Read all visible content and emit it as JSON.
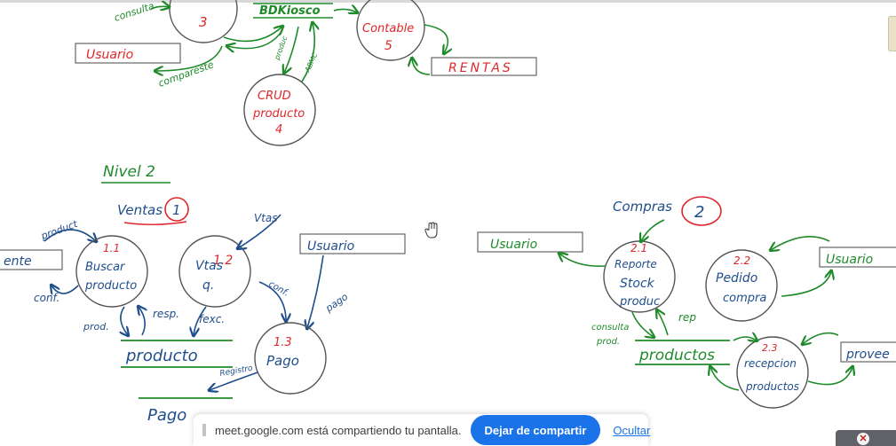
{
  "colors": {
    "blue": "#1f4e8c",
    "red": "#e0262b",
    "green": "#1f8a2a"
  },
  "level0": {
    "process3": "3",
    "store_bd": "BDKiosco",
    "label_consulta": "consulta",
    "store_usuario": "Usuario",
    "label_compare": "compareste",
    "process_contable": "Contable",
    "process_contable_num": "5",
    "store_rentas": "RENTAS",
    "process_crud_1": "CRUD",
    "process_crud_2": "producto",
    "process_crud_num": "4",
    "label_prod_a": "produc",
    "label_prod_b": "ABMC"
  },
  "level2": {
    "heading": "Nivel 2",
    "ventas_label": "Ventas",
    "ventas_num": "1",
    "ext_left": "ente",
    "label_product": "product",
    "p11_num": "1.1",
    "p11_line1": "Buscar",
    "p11_line2": "producto",
    "label_conf": "conf.",
    "label_ventas_flow": "Vtas",
    "p12_num": "1.2",
    "p12_line1": "Vtas",
    "p12_line2": "q.",
    "store_usuario": "Usuario",
    "label_conf2": "conf.",
    "label_pago": "pago",
    "label_prod": "prod.",
    "label_resp": "resp.",
    "label_fexc": "fexc.",
    "store_producto": "producto",
    "p13_num": "1.3",
    "p13_line1": "Pago",
    "label_registro": "Registro",
    "store_pago": "Pago"
  },
  "compras": {
    "label": "Compras",
    "num": "2",
    "store_usuario_left": "Usuario",
    "p21_num": "2.1",
    "p21_line1": "Reporte",
    "p21_line2": "Stock",
    "p21_line3": "produc",
    "p22_num": "2.2",
    "p22_line1": "Pedido",
    "p22_line2": "compra",
    "store_usuario_right": "Usuario",
    "label_consulta": "consulta",
    "label_prod": "prod.",
    "label_rep": "rep",
    "store_productos": "productos",
    "p23_num": "2.3",
    "p23_line1": "recepcion",
    "p23_line2": "productos",
    "store_proveedor": "provee"
  },
  "share_bar": {
    "message": "meet.google.com está compartiendo tu pantalla.",
    "stop_button": "Dejar de compartir",
    "hide_link": "Ocultar"
  }
}
